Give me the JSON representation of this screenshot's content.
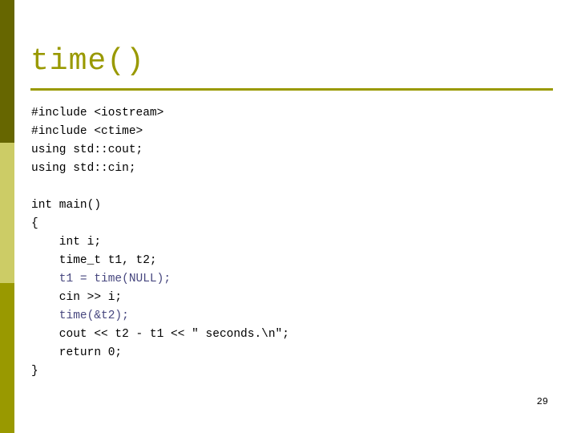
{
  "theme": {
    "background": "#ffffff",
    "sidebar_dark": "#666600",
    "sidebar_light": "#cccc66",
    "sidebar_olive": "#999900",
    "title_color": "#999900",
    "rule_color": "#999900",
    "code_color": "#000000",
    "code_highlight_color": "#47477f"
  },
  "slide": {
    "title": "time()",
    "page_number": "29"
  },
  "code": {
    "language": "cpp",
    "lines": [
      {
        "text": "#include <iostream>",
        "indent": 0,
        "color": "code"
      },
      {
        "text": "#include <ctime>",
        "indent": 0,
        "color": "code"
      },
      {
        "text": "using std::cout;",
        "indent": 0,
        "color": "code"
      },
      {
        "text": "using std::cin;",
        "indent": 0,
        "color": "code"
      },
      {
        "text": "",
        "indent": 0,
        "color": "code"
      },
      {
        "text": "int main()",
        "indent": 0,
        "color": "code"
      },
      {
        "text": "{",
        "indent": 0,
        "color": "code"
      },
      {
        "text": "    int i;",
        "indent": 1,
        "color": "code"
      },
      {
        "text": "    time_t t1, t2;",
        "indent": 1,
        "color": "code"
      },
      {
        "text": "    t1 = time(NULL);",
        "indent": 1,
        "color": "highlight"
      },
      {
        "text": "    cin >> i;",
        "indent": 1,
        "color": "code"
      },
      {
        "text": "    time(&t2);",
        "indent": 1,
        "color": "highlight"
      },
      {
        "text": "    cout << t2 - t1 << \" seconds.\\n\";",
        "indent": 1,
        "color": "code"
      },
      {
        "text": "    return 0;",
        "indent": 1,
        "color": "code"
      },
      {
        "text": "}",
        "indent": 0,
        "color": "code"
      }
    ]
  },
  "sidebar": {
    "bands": [
      {
        "name": "band-top",
        "color": "#666600"
      },
      {
        "name": "band-middle",
        "color": "#cccc66"
      },
      {
        "name": "band-bottom",
        "color": "#999900"
      }
    ]
  }
}
